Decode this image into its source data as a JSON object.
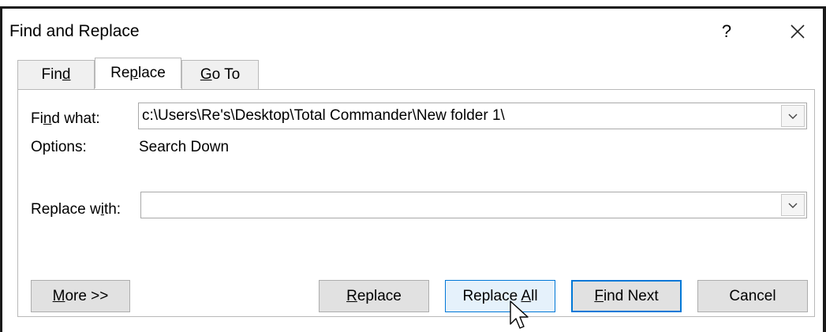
{
  "window": {
    "title": "Find and Replace",
    "help_label": "?",
    "close_label": "×"
  },
  "tabs": [
    {
      "pre": "Fin",
      "accel": "d",
      "post": "",
      "active": false
    },
    {
      "pre": "Re",
      "accel": "p",
      "post": "lace",
      "active": true
    },
    {
      "pre": "",
      "accel": "G",
      "post": "o To",
      "active": false
    }
  ],
  "find": {
    "label_pre": "Fi",
    "label_accel": "n",
    "label_post": "d what:",
    "value": "c:\\Users\\Re's\\Desktop\\Total Commander\\New folder 1\\"
  },
  "options": {
    "label": "Options:",
    "value": "Search Down"
  },
  "replace": {
    "label_pre": "Replace w",
    "label_accel": "i",
    "label_post": "th:",
    "value": ""
  },
  "buttons": {
    "more": {
      "pre": "",
      "accel": "M",
      "post": "ore >>"
    },
    "replace": {
      "pre": "",
      "accel": "R",
      "post": "eplace"
    },
    "replace_all": {
      "pre": "Replace ",
      "accel": "A",
      "post": "ll"
    },
    "find_next": {
      "pre": "",
      "accel": "F",
      "post": "ind Next"
    },
    "cancel": {
      "label": "Cancel"
    }
  },
  "colors": {
    "accent": "#0078d7",
    "button_face": "#e1e1e1",
    "button_hover": "#e5f1fb"
  }
}
